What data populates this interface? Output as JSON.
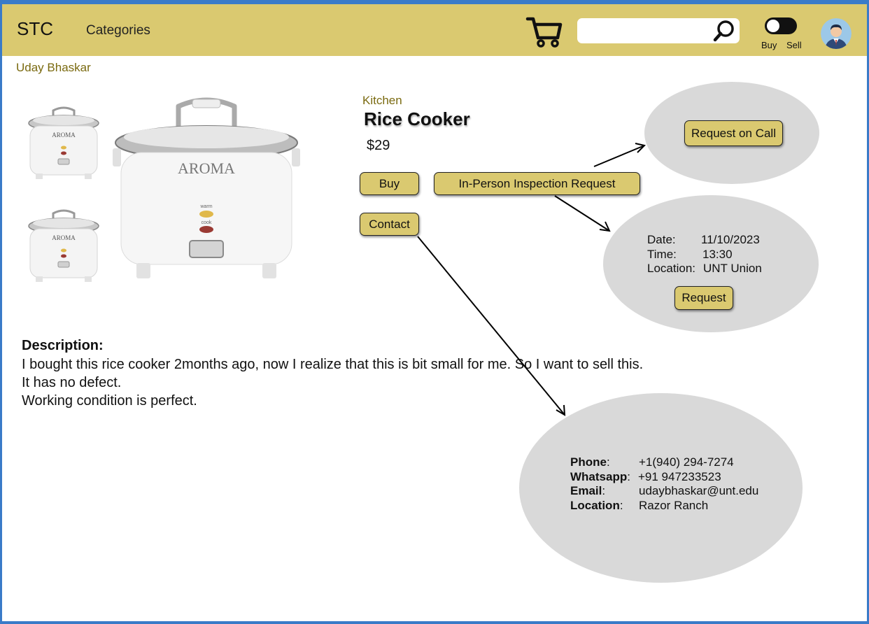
{
  "header": {
    "logo": "STC",
    "categories": "Categories",
    "search": {
      "value": "",
      "placeholder": ""
    },
    "toggle": {
      "left": "Buy",
      "right": "Sell"
    },
    "icons": {
      "cart": "shopping-cart-icon",
      "search": "search-icon",
      "avatar": "user-avatar"
    }
  },
  "seller": "Uday Bhaskar",
  "product": {
    "category": "Kitchen",
    "title": "Rice Cooker",
    "price": "$29",
    "brand_on_image": "AROMA",
    "image_labels": [
      "warm",
      "cook"
    ]
  },
  "actions": {
    "buy": "Buy",
    "inspection": "In-Person Inspection Request",
    "contact": "Contact"
  },
  "call_popup": {
    "button": "Request on Call"
  },
  "inspection_popup": {
    "date_label": "Date:",
    "date": "11/10/2023",
    "time_label": "Time:",
    "time": "13:30",
    "location_label": "Location:",
    "location": "UNT Union",
    "button": "Request"
  },
  "description": {
    "heading": "Description:",
    "lines": [
      "I bought this rice cooker 2months ago, now I realize that this is bit small for me. So I want to sell this.",
      "It has no defect.",
      "Working condition is perfect."
    ]
  },
  "contact_popup": {
    "phone_label": "Phone",
    "phone": "+1(940) 294-7274",
    "whatsapp_label": "Whatsapp",
    "whatsapp": "+91 947233523",
    "email_label": "Email",
    "email": "udaybhaskar@unt.edu",
    "location_label": "Location",
    "location": "Razor Ranch"
  },
  "colors": {
    "accent": "#dac970",
    "frame": "#3a7bc8",
    "popup": "#d9d9d9",
    "label": "#7a6a10"
  }
}
